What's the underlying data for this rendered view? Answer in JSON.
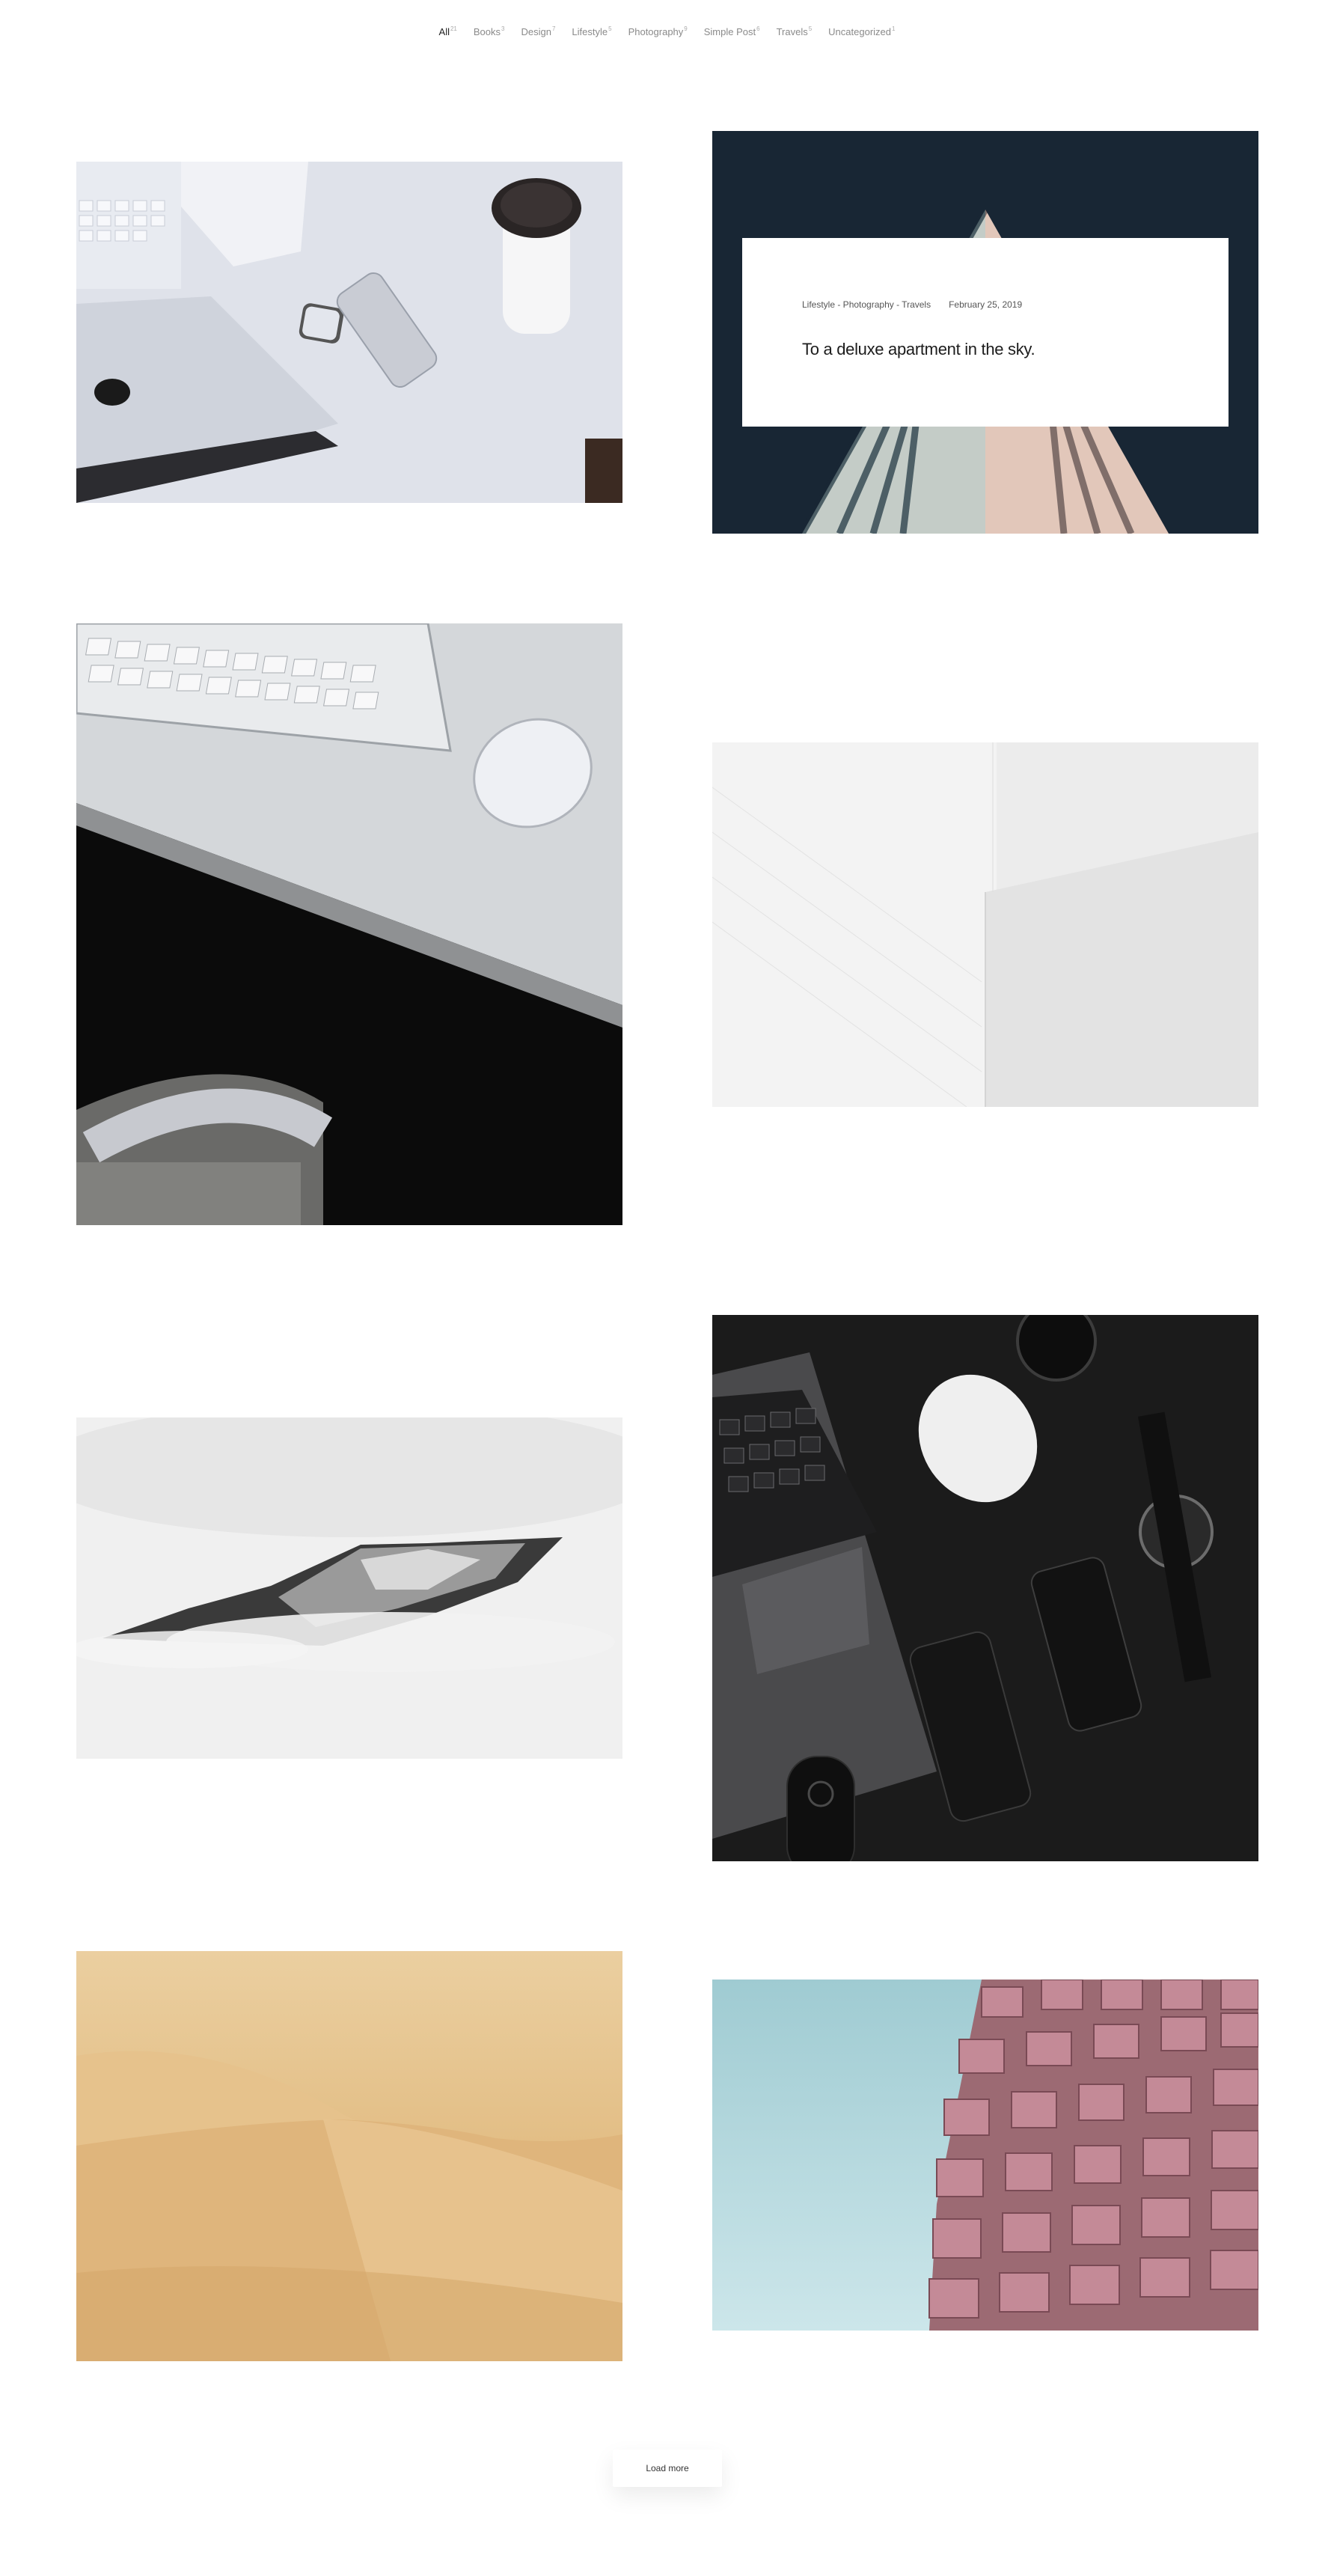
{
  "filters": [
    {
      "label": "All",
      "count": "21",
      "active": true
    },
    {
      "label": "Books",
      "count": "3"
    },
    {
      "label": "Design",
      "count": "7"
    },
    {
      "label": "Lifestyle",
      "count": "5"
    },
    {
      "label": "Photography",
      "count": "9"
    },
    {
      "label": "Simple Post",
      "count": "6"
    },
    {
      "label": "Travels",
      "count": "5"
    },
    {
      "label": "Uncategorized",
      "count": "1"
    }
  ],
  "featured_post": {
    "categories": "Lifestyle - Photography - Travels",
    "date": "February 25, 2019",
    "title": "To a deluxe apartment in the sky."
  },
  "cards": [
    {
      "subject": "laptop-phone-desk"
    },
    {
      "subject": "building-facade-dark"
    },
    {
      "subject": "keyboard-mouse-desk"
    },
    {
      "subject": "white-architecture"
    },
    {
      "subject": "misty-mountain"
    },
    {
      "subject": "dark-laptop-phones"
    },
    {
      "subject": "desert-sand-dunes"
    },
    {
      "subject": "pink-building-balconies"
    }
  ],
  "load_more_label": "Load more",
  "colors": {
    "building_bg": "#182634",
    "sky": "#9fcbd2",
    "sand": "#e2bd84",
    "balcony": "#b67c8a"
  }
}
